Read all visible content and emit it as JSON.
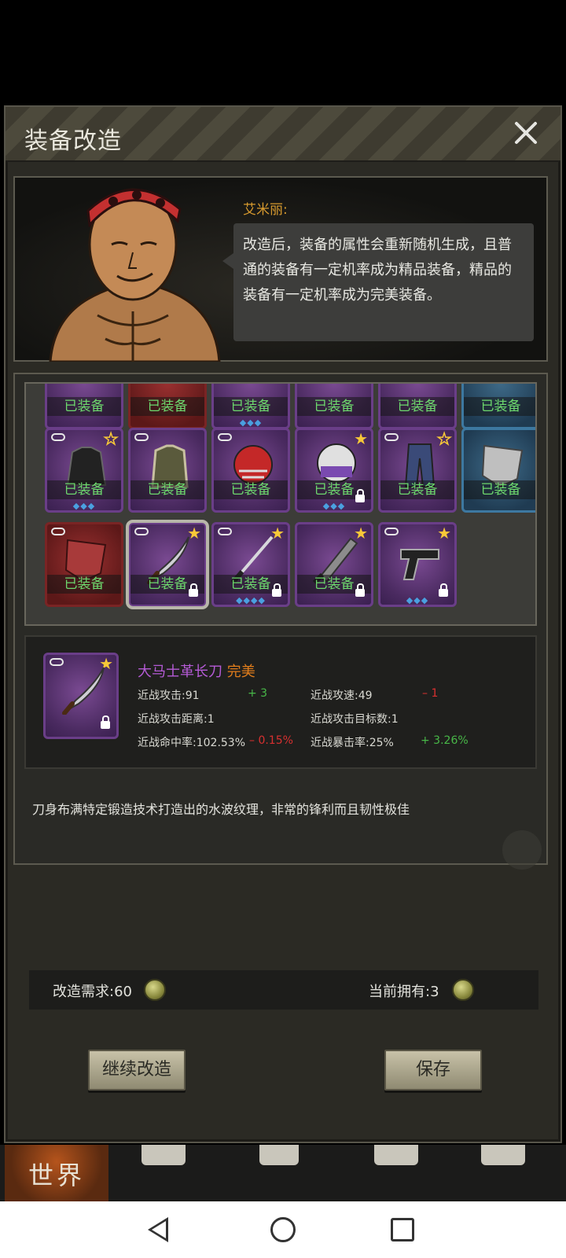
{
  "modal": {
    "title": "装备改造"
  },
  "npc": {
    "name": "艾米丽:",
    "dialog": "改造后，装备的属性会重新随机生成，且普通的装备有一定机率成为精品装备，精品的装备有一定机率成为完美装备。"
  },
  "inventory": {
    "equipped_label": "已装备",
    "rows": [
      {
        "slots": [
          {
            "rarity": "purple",
            "equipped": true,
            "gems": ""
          },
          {
            "rarity": "red",
            "equipped": true,
            "gems": ""
          },
          {
            "rarity": "purple",
            "equipped": true,
            "gems": "◆◆◆"
          },
          {
            "rarity": "purple",
            "equipped": true,
            "gems": ""
          },
          {
            "rarity": "purple",
            "equipped": true,
            "gems": ""
          },
          {
            "rarity": "blue",
            "equipped": true,
            "gems": ""
          }
        ]
      },
      {
        "slots": [
          {
            "rarity": "purple",
            "item": "jacket",
            "equipped": true,
            "link": true,
            "star": "outline",
            "gems": "◆◆◆"
          },
          {
            "rarity": "purple",
            "item": "fur-coat",
            "equipped": true,
            "link": true,
            "star": "none",
            "gems": ""
          },
          {
            "rarity": "purple",
            "item": "football-helmet",
            "equipped": true,
            "link": true,
            "star": "none",
            "gems": ""
          },
          {
            "rarity": "purple",
            "item": "police-helmet",
            "equipped": true,
            "link": false,
            "star": "filled",
            "lock": true,
            "gems": "◆◆◆"
          },
          {
            "rarity": "purple",
            "item": "jeans",
            "equipped": true,
            "link": true,
            "star": "outline",
            "gems": ""
          },
          {
            "rarity": "blue",
            "item": "shield",
            "equipped": true,
            "link": false,
            "star": "none",
            "gems": ""
          }
        ]
      },
      {
        "slots": [
          {
            "rarity": "red",
            "item": "red-shield",
            "equipped": true,
            "link": true,
            "star": "none",
            "gems": ""
          },
          {
            "rarity": "purple",
            "item": "damascus-sword",
            "equipped": true,
            "link": true,
            "star": "filled",
            "lock": true,
            "selected": true,
            "gems": ""
          },
          {
            "rarity": "purple",
            "item": "katana",
            "equipped": true,
            "link": true,
            "star": "filled",
            "lock": true,
            "gems": "◆◆◆◆"
          },
          {
            "rarity": "purple",
            "item": "machete",
            "equipped": true,
            "link": false,
            "star": "filled",
            "lock": true,
            "gems": ""
          },
          {
            "rarity": "purple",
            "item": "pistol",
            "equipped": false,
            "link": true,
            "star": "filled",
            "lock": true,
            "gems": "◆◆◆"
          }
        ]
      }
    ]
  },
  "detail": {
    "name": "大马士革长刀",
    "quality": "完美",
    "stats": {
      "melee_attack": "近战攻击:91",
      "melee_attack_delta": "+ 3",
      "melee_speed": "近战攻速:49",
      "melee_speed_delta": "– 1",
      "melee_range": "近战攻击距离:1",
      "melee_targets": "近战攻击目标数:1",
      "melee_hit": "近战命中率:102.53%",
      "melee_hit_delta": "– 0.15%",
      "melee_crit": "近战暴击率:25%",
      "melee_crit_delta": "+ 3.26%"
    },
    "description": "刀身布满特定锻造技术打造出的水波纹理，非常的锋利而且韧性极佳"
  },
  "cost": {
    "required_label": "改造需求:60",
    "owned_label": "当前拥有:3"
  },
  "buttons": {
    "continue": "继续改造",
    "save": "保存"
  },
  "tabs": {
    "world": "世界"
  }
}
